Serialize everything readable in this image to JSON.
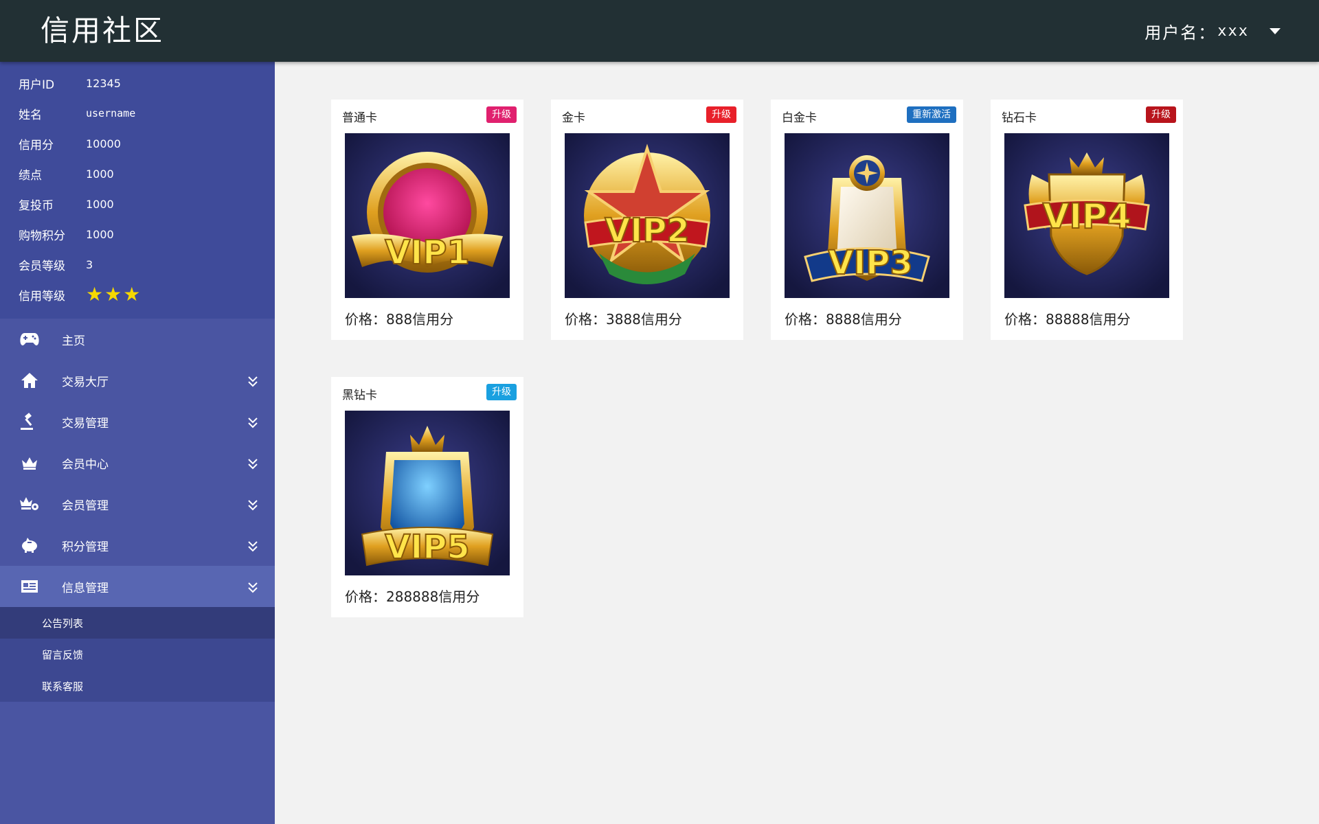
{
  "header": {
    "title": "信用社区",
    "user_label": "用户名：",
    "user_name": "xxx"
  },
  "profile": {
    "rows": [
      {
        "label": "用户ID",
        "value": "12345"
      },
      {
        "label": "姓名",
        "value": "username"
      },
      {
        "label": "信用分",
        "value": "10000"
      },
      {
        "label": "绩点",
        "value": "1000"
      },
      {
        "label": "复投币",
        "value": "1000"
      },
      {
        "label": "购物积分",
        "value": "1000"
      },
      {
        "label": "会员等级",
        "value": "3"
      }
    ],
    "credit_level_label": "信用等级",
    "credit_stars": 3
  },
  "nav": {
    "items": [
      {
        "label": "主页",
        "icon": "gamepad-icon"
      },
      {
        "label": "交易大厅",
        "icon": "home-icon"
      },
      {
        "label": "交易管理",
        "icon": "gavel-icon"
      },
      {
        "label": "会员中心",
        "icon": "crown-icon"
      },
      {
        "label": "会员管理",
        "icon": "crown-gear-icon"
      },
      {
        "label": "积分管理",
        "icon": "piggy-bank-icon"
      },
      {
        "label": "信息管理",
        "icon": "newspaper-icon"
      }
    ],
    "submenu": [
      "公告列表",
      "留言反馈",
      "联系客服"
    ]
  },
  "cards": [
    {
      "name": "普通卡",
      "badge": "升级",
      "badge_color": "#e0206e",
      "vip": "VIP1",
      "price_label": "价格：",
      "price": "888信用分"
    },
    {
      "name": "金卡",
      "badge": "升级",
      "badge_color": "#e8202a",
      "vip": "VIP2",
      "price_label": "价格：",
      "price": "3888信用分"
    },
    {
      "name": "白金卡",
      "badge": "重新激活",
      "badge_color": "#1e6fc0",
      "vip": "VIP3",
      "price_label": "价格：",
      "price": "8888信用分"
    },
    {
      "name": "钻石卡",
      "badge": "升级",
      "badge_color": "#b8141c",
      "vip": "VIP4",
      "price_label": "价格：",
      "price": "88888信用分"
    },
    {
      "name": "黑钻卡",
      "badge": "升级",
      "badge_color": "#1aa0e0",
      "vip": "VIP5",
      "price_label": "价格：",
      "price": "288888信用分"
    }
  ],
  "colors": {
    "header_bg": "#223034",
    "sidebar_bg": "#4a55a2",
    "profile_bg": "#3f4b9a",
    "active_nav_bg": "#5866b2",
    "submenu_bg": "#3d4891",
    "submenu_selected_bg": "#333c7a",
    "star": "#f5d800",
    "content_bg": "#f2f2f2"
  }
}
